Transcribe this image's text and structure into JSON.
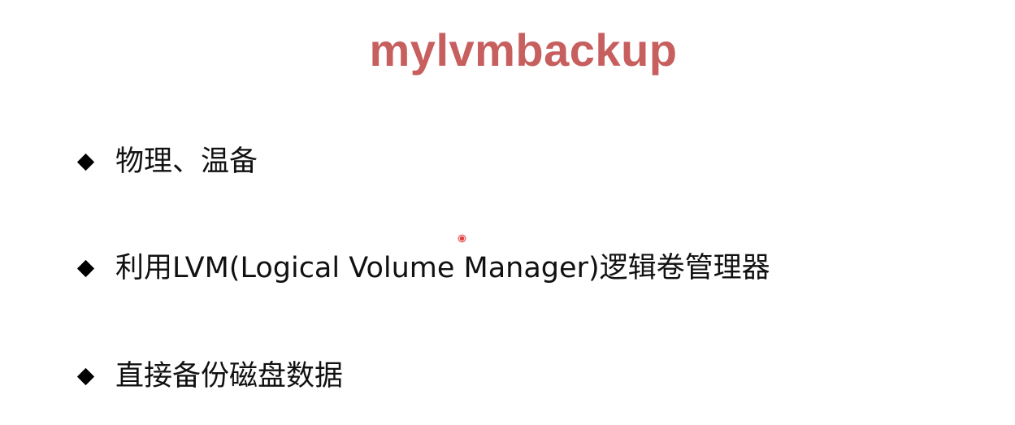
{
  "slide": {
    "title": "mylvmbackup",
    "bullets": [
      {
        "icon": "diamond-bullet-icon",
        "text": "物理、温备"
      },
      {
        "icon": "diamond-bullet-icon",
        "text": "利用LVM(Logical Volume Manager)逻辑卷管理器"
      },
      {
        "icon": "diamond-bullet-icon",
        "text": "直接备份磁盘数据"
      }
    ]
  },
  "colors": {
    "title": "#c75f5f",
    "text": "#111111",
    "bullet": "#000000",
    "background": "#ffffff",
    "cursor": "#e43b3b"
  }
}
